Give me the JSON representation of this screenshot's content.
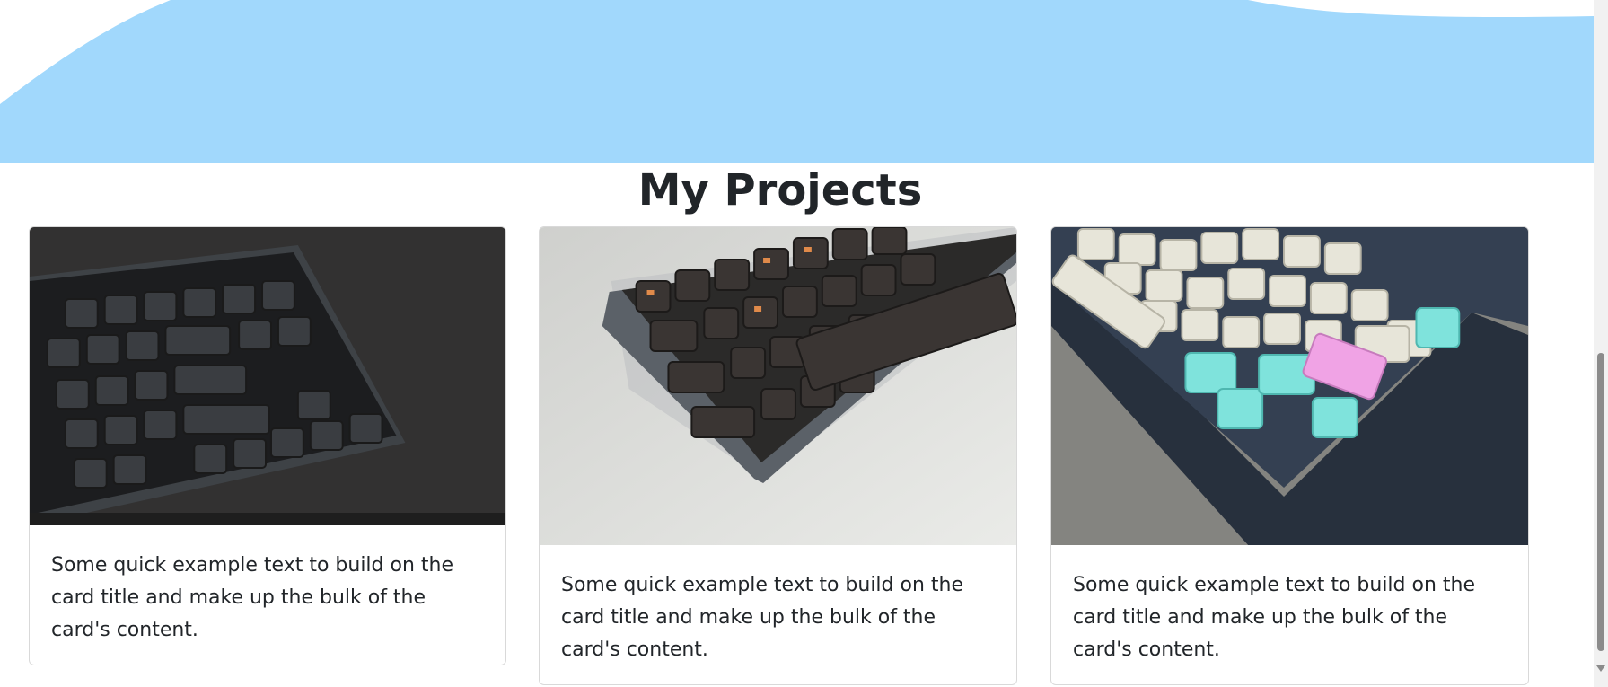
{
  "section": {
    "title": "My Projects"
  },
  "colors": {
    "hero_wave": "#a1d8fc",
    "text": "#212529"
  },
  "projects": [
    {
      "image_icon": "keyboard-dark-photo",
      "text": "Some quick example text to build on the card title and make up the bulk of the card's content."
    },
    {
      "image_icon": "keyboard-gray-photo",
      "text": "Some quick example text to build on the card title and make up the bulk of the card's content."
    },
    {
      "image_icon": "keyboard-pastel-photo",
      "text": "Some quick example text to build on the card title and make up the bulk of the card's content."
    }
  ]
}
